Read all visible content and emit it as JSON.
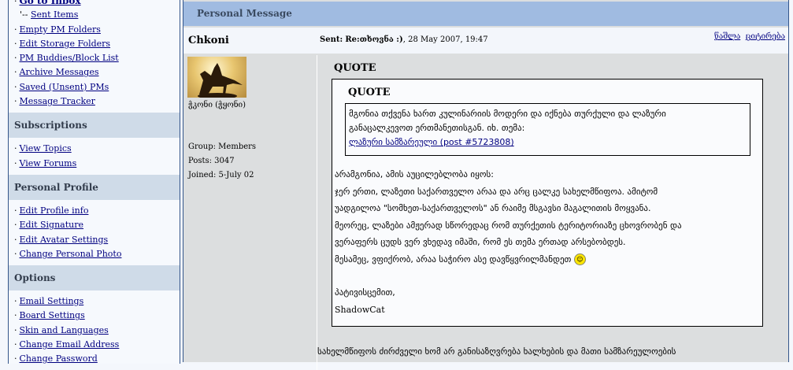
{
  "sidebar": {
    "inbox": "Go to Inbox",
    "sent_prefix": "'--",
    "sent": "Sent Items",
    "pm_items": [
      "Empty PM Folders",
      "Edit Storage Folders",
      "PM Buddies/Block List",
      "Archive Messages",
      "Saved (Unsent) PMs",
      "Message Tracker"
    ],
    "subscriptions": {
      "title": "Subscriptions",
      "items": [
        "View Topics",
        "View Forums"
      ]
    },
    "profile": {
      "title": "Personal Profile",
      "items": [
        "Edit Profile info",
        "Edit Signature",
        "Edit Avatar Settings",
        "Change Personal Photo"
      ]
    },
    "options": {
      "title": "Options",
      "items": [
        "Email Settings",
        "Board Settings",
        "Skin and Languages",
        "Change Email Address",
        "Change Password"
      ]
    }
  },
  "message": {
    "header": "Personal Message",
    "author": "Chkoni",
    "sent_label": "Sent:",
    "subject": "Re:თხოვნა :)",
    "date": ", 28 May 2007, 19:47",
    "actions": [
      "წაშლა",
      "ციტირება"
    ],
    "user_title": "ჭკონი (ჭყონი)",
    "group": "Group: Members",
    "posts": "Posts: 3047",
    "joined": "Joined: 5-July 02",
    "quote_label": "QUOTE",
    "inner_quote_label": "QUOTE",
    "inner_quote_lines": [
      "მგონია თქვენა ხართ კულინარიის მოდერი და იქნება თურქული და ლაზური",
      "განაცალკევოთ ერთმანეთისგან. იხ. თემა:"
    ],
    "inner_quote_link": "ლაზური სამზარეული (post #5723808)",
    "body_lines": [
      "არამგონია, ამის აუცილებლობა იყოს:",
      "ჯერ ერთი, ლაზეთი საქართველო არაა და არც ცალკე სახელმწიფოა. ამიტომ",
      "უადგილოა \"სომხეთ-საქართველოს\" ან რაიმე მსგავსი მაგალითის მოყვანა.",
      "მეორეც, ლაზები ამჟერად სწორედაც რომ თურქეთის ტერიტორიაზე ცხოვრობენ და",
      "ვერაფერს ცუდს ვერ ვხედავ იმაში, რომ ეს თემა ერთად არსებობდეს.",
      "მესამეც, ვფიქრობ, არაა საჭირო ასე დავწყვრილმანდეთ"
    ],
    "regards": "პატივისცემით,",
    "signature": "ShadowCat",
    "bottom_line": "სახელმწიფოს ძირძველი ხომ არ განისაზღვრება ხალხების და მათი სამზარეულოების"
  }
}
